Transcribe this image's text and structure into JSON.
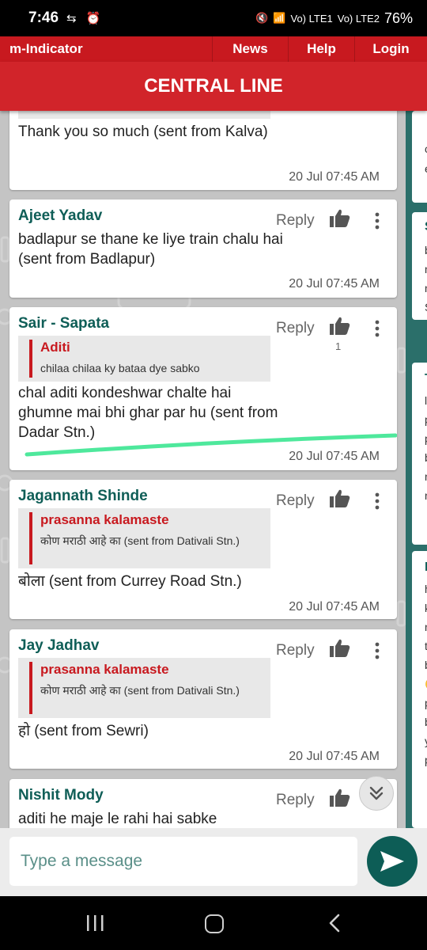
{
  "status_bar": {
    "time": "7:46",
    "left_icons": "sync-icon alarm-icon",
    "network_1": "Vo) LTE1",
    "network_2": "Vo) LTE2",
    "battery": "76%"
  },
  "nav": {
    "brand": "m-Indicator",
    "items": [
      "News",
      "Help",
      "Login"
    ]
  },
  "title": "CENTRAL LINE",
  "reply_label": "Reply",
  "colors": {
    "brand_red": "#c8191f",
    "name_green": "#0f5e57",
    "accent_teal": "#0d5d56"
  },
  "messages": [
    {
      "text": "Thank you so much  (sent from Kalva)",
      "time": "20 Jul 07:45 AM"
    },
    {
      "name": "Ajeet Yadav",
      "text": "badlapur se thane ke liye train chalu hai  (sent from Badlapur)",
      "time": "20 Jul 07:45 AM"
    },
    {
      "name": "Sair - Sapata",
      "likes": "1",
      "quote": {
        "name": "Aditi",
        "text": "chilaa chilaa ky bataa dye sabko"
      },
      "text": "chal aditi kondeshwar chalte hai ghumne mai bhi ghar par hu (sent from Dadar Stn.)",
      "time": "20 Jul 07:45 AM"
    },
    {
      "name": "Jagannath Shinde",
      "quote": {
        "name": "prasanna kalamaste",
        "text": "कोण मराठी आहे का (sent from Dativali Stn.)"
      },
      "text": "बोला (sent from Currey Road Stn.)",
      "time": "20 Jul 07:45 AM"
    },
    {
      "name": "Jay Jadhav",
      "quote": {
        "name": "prasanna kalamaste",
        "text": "कोण मराठी आहे का (sent from Dativali Stn.)"
      },
      "text": "हो  (sent from Sewri)",
      "time": "20 Jul 07:45 AM"
    },
    {
      "name": "Nishit Mody",
      "text": "aditi he maje le rahi hai sabke"
    }
  ],
  "input": {
    "placeholder": "Type a message"
  }
}
